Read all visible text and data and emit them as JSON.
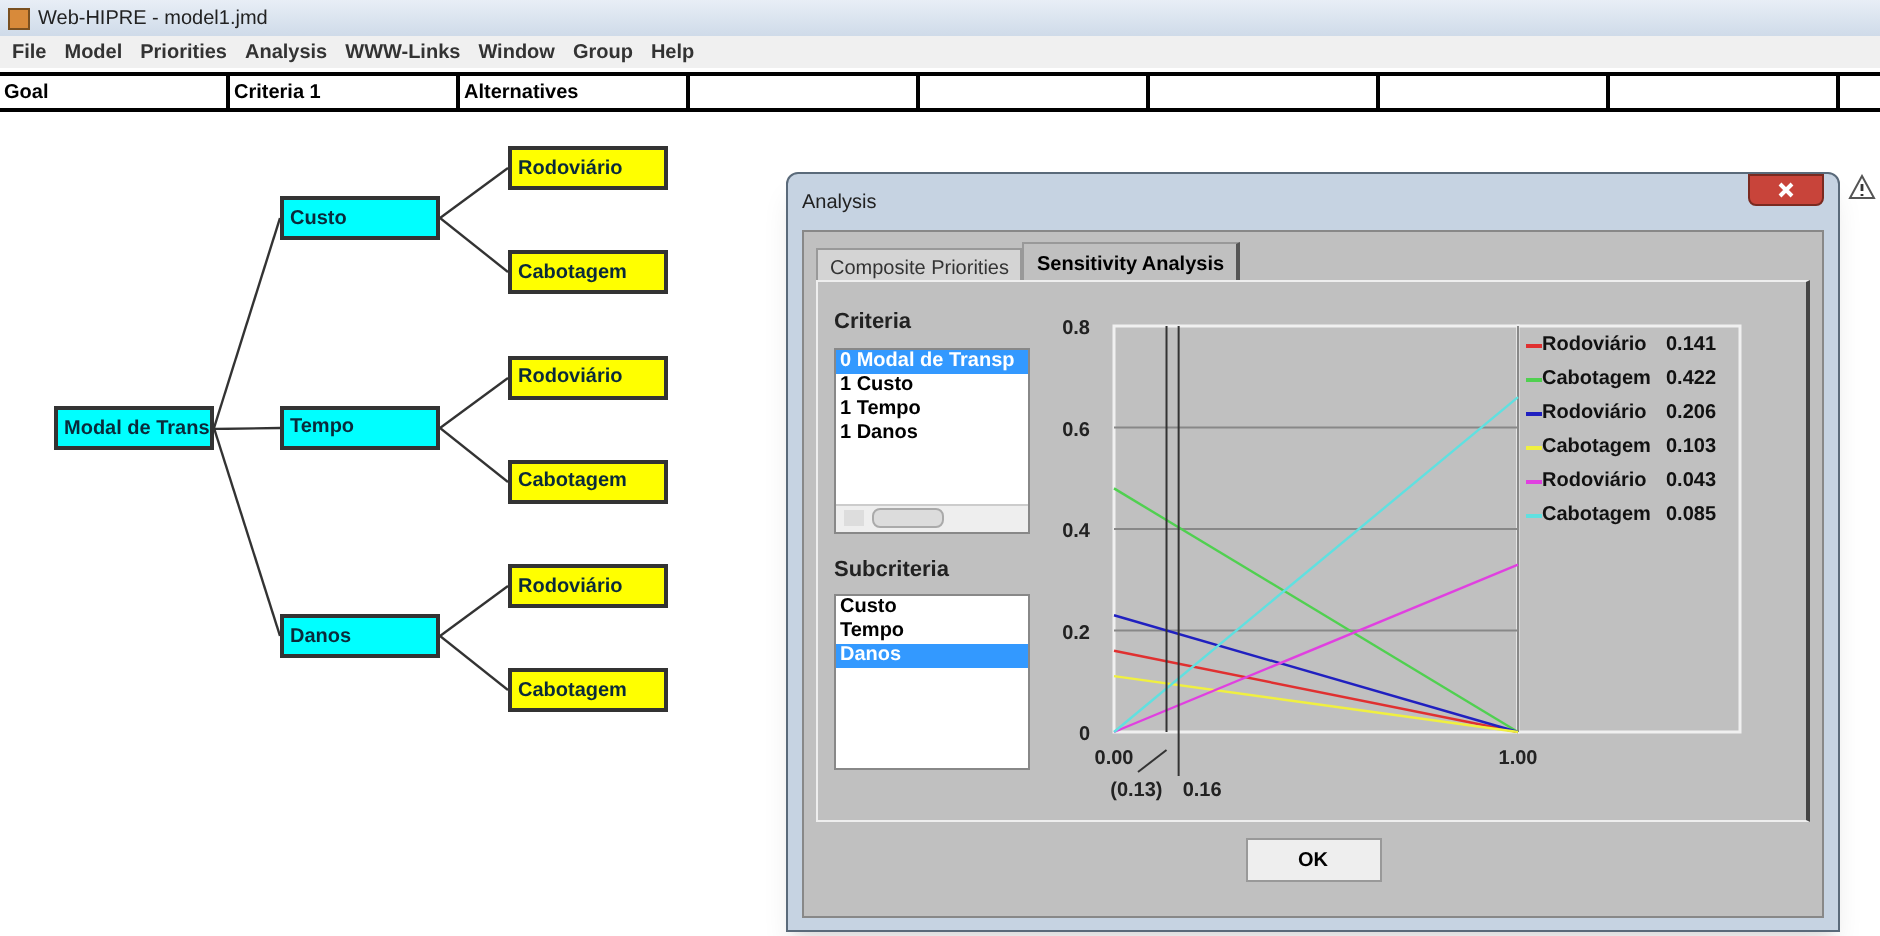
{
  "window": {
    "title": "Web-HIPRE - model1.jmd"
  },
  "menu": [
    "File",
    "Model",
    "Priorities",
    "Analysis",
    "WWW-Links",
    "Window",
    "Group",
    "Help"
  ],
  "levels": [
    "Goal",
    "Criteria 1",
    "Alternatives"
  ],
  "tree": {
    "label": "Modal de Trans",
    "children": [
      {
        "label": "Custo",
        "children": [
          {
            "label": "Rodoviário"
          },
          {
            "label": "Cabotagem"
          }
        ]
      },
      {
        "label": "Tempo",
        "children": [
          {
            "label": "Rodoviário"
          },
          {
            "label": "Cabotagem"
          }
        ]
      },
      {
        "label": "Danos",
        "children": [
          {
            "label": "Rodoviário"
          },
          {
            "label": "Cabotagem"
          }
        ]
      }
    ]
  },
  "dialog": {
    "title": "Analysis",
    "tabs": [
      {
        "label": "Composite Priorities",
        "selected": false
      },
      {
        "label": "Sensitivity Analysis",
        "selected": true
      }
    ],
    "criteria": {
      "label": "Criteria",
      "items": [
        {
          "label": "0 Modal de Transp",
          "selected": true
        },
        {
          "label": "1 Custo",
          "selected": false
        },
        {
          "label": "1 Tempo",
          "selected": false
        },
        {
          "label": "1 Danos",
          "selected": false
        }
      ]
    },
    "subcriteria": {
      "label": "Subcriteria",
      "items": [
        {
          "label": "Custo",
          "selected": false
        },
        {
          "label": "Tempo",
          "selected": false
        },
        {
          "label": "Danos",
          "selected": true
        }
      ]
    },
    "legend_values": [
      "0.141",
      "0.422",
      "0.206",
      "0.103",
      "0.043",
      "0.085"
    ],
    "chart_data": {
      "type": "line",
      "grid": true,
      "legend": "right",
      "x": [
        0,
        1
      ],
      "xticks": [
        {
          "value": 0,
          "label": "0.00"
        },
        {
          "value": 1,
          "label": "1.00"
        }
      ],
      "yticks": [
        0,
        {
          "value": 0.2,
          "label": "0.2"
        },
        {
          "value": 0.4,
          "label": "0.4"
        },
        {
          "value": 0.6,
          "label": "0.6"
        },
        {
          "value": 0.8,
          "label": "0.8"
        }
      ],
      "ylim": [
        0,
        0.8
      ],
      "xlim": [
        0,
        1
      ],
      "series": [
        {
          "name": "Rodoviário",
          "color": "#e03030",
          "values": [
            0.16,
            0
          ]
        },
        {
          "name": "Cabotagem",
          "color": "#50d050",
          "values": [
            0.48,
            0
          ]
        },
        {
          "name": "Rodoviário",
          "color": "#2020c0",
          "values": [
            0.23,
            0
          ]
        },
        {
          "name": "Cabotagem",
          "color": "#f0f040",
          "values": [
            0.11,
            0
          ]
        },
        {
          "name": "Rodoviário",
          "color": "#e040e0",
          "values": [
            0,
            0.33
          ]
        },
        {
          "name": "Cabotagem",
          "color": "#60e0e0",
          "values": [
            0,
            0.66
          ]
        }
      ],
      "ref_lines": [
        {
          "axis": "x",
          "value": 0.13,
          "label": "(0.13)"
        },
        {
          "axis": "x",
          "value": 0.16,
          "label": "0.16"
        }
      ]
    },
    "ok_button": "OK"
  }
}
